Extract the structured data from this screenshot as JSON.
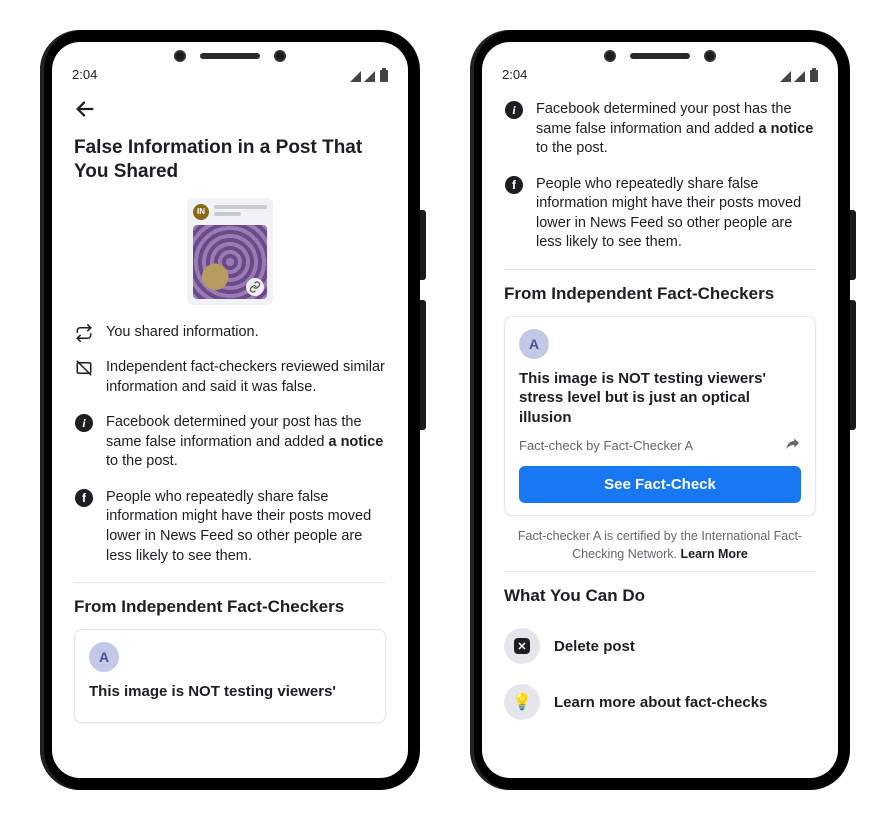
{
  "status": {
    "time": "2:04"
  },
  "screen1": {
    "title": "False Information in a Post That You Shared",
    "thumb_avatar": "IN",
    "items": [
      {
        "icon": "retweet",
        "text": "You shared information."
      },
      {
        "icon": "image-slash",
        "text": "Independent fact-checkers reviewed similar information and said it was false."
      },
      {
        "icon": "info",
        "html": "Facebook determined your post has the same false information and added <b>a notice</b> to the post."
      },
      {
        "icon": "facebook",
        "text": "People who repeatedly share false information might have their posts moved lower in News Feed so other people are less likely to see them."
      }
    ],
    "section_fc": "From Independent Fact-Checkers",
    "fc_avatar": "A",
    "fc_title_partial": "This image is NOT testing viewers'"
  },
  "screen2": {
    "items": [
      {
        "icon": "info",
        "html": "Facebook determined your post has the same false information and added <b>a notice</b> to the post."
      },
      {
        "icon": "facebook",
        "text": "People who repeatedly share false information might have their posts moved lower in News Feed so other people are less likely to see them."
      }
    ],
    "section_fc": "From Independent Fact-Checkers",
    "fc": {
      "avatar": "A",
      "title": "This image is NOT testing viewers' stress level but is just an optical illusion",
      "byline": "Fact-check by Fact-Checker A",
      "button": "See Fact-Check"
    },
    "cert_note_pre": "Fact-checker A is certified by the International Fact-Checking Network. ",
    "cert_note_link": "Learn More",
    "section_actions": "What You Can Do",
    "actions": {
      "delete": "Delete post",
      "learn": "Learn more about fact-checks"
    }
  }
}
